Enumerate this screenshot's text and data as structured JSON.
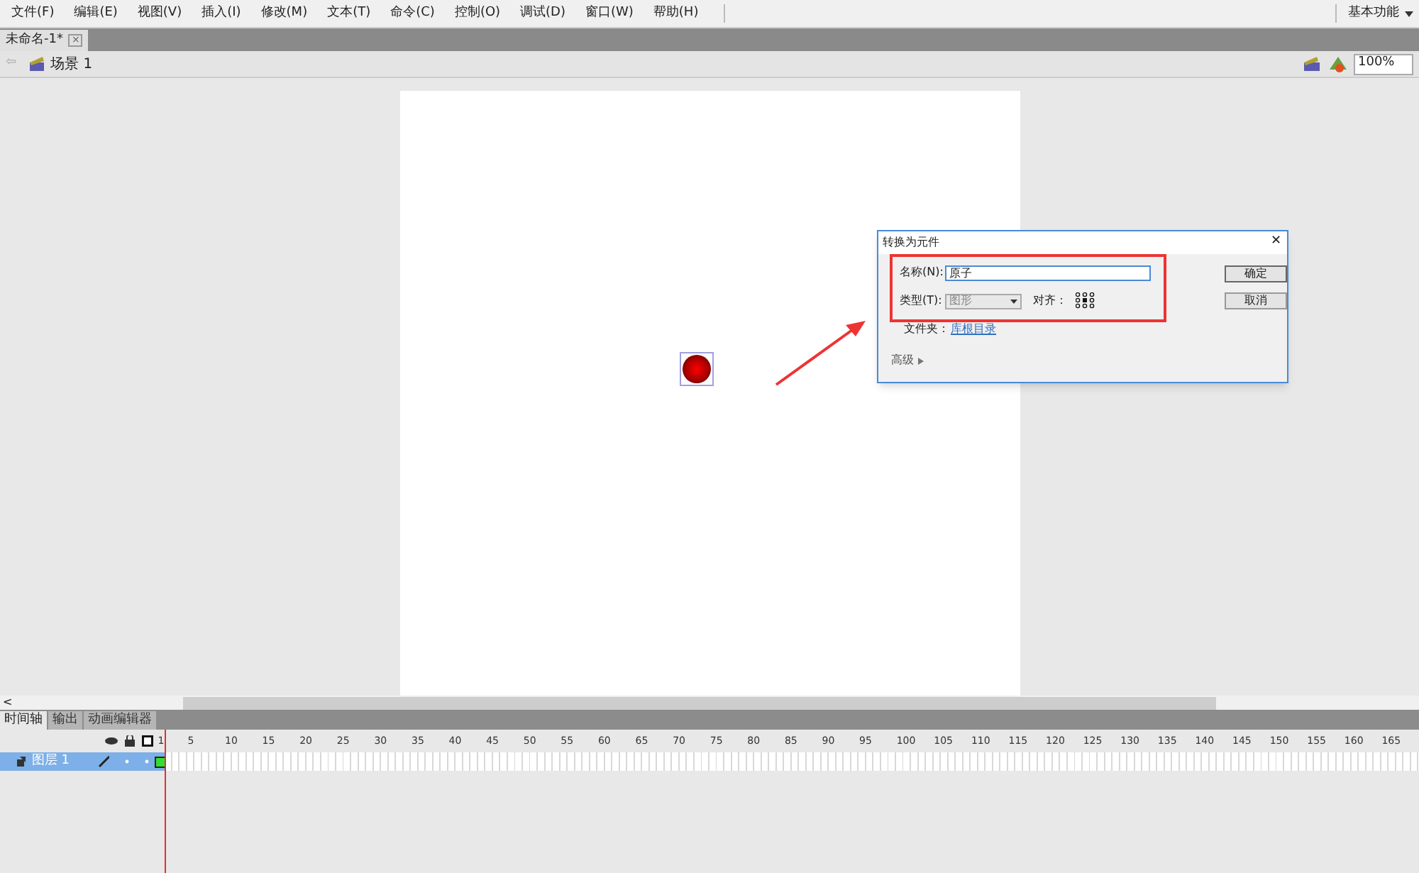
{
  "menu": [
    "文件(F)",
    "编辑(E)",
    "视图(V)",
    "插入(I)",
    "修改(M)",
    "文本(T)",
    "命令(C)",
    "控制(O)",
    "调试(D)",
    "窗口(W)",
    "帮助(H)"
  ],
  "workspace": "基本功能",
  "document_tab": {
    "label": "未命名-1*",
    "close": "×"
  },
  "scene": {
    "back": "⇦",
    "label": "场景 1",
    "zoom": "100%"
  },
  "dialog": {
    "title": "转换为元件",
    "close": "✕",
    "name_label": "名称(N):",
    "name_value": "原子",
    "type_label": "类型(T):",
    "type_value": "图形",
    "align_label": "对齐：",
    "folder_label": "文件夹：",
    "folder_link": "库根目录",
    "advanced": "高级",
    "ok": "确定",
    "cancel": "取消"
  },
  "scroll": {
    "left": "<"
  },
  "timeline_tabs": [
    {
      "label": "时间轴",
      "selected": true
    },
    {
      "label": "输出",
      "selected": false
    },
    {
      "label": "动画编辑器",
      "selected": false
    }
  ],
  "frame_numbers": [
    "1",
    "5",
    "10",
    "15",
    "20",
    "25",
    "30",
    "35",
    "40",
    "45",
    "50",
    "55",
    "60",
    "65",
    "70",
    "75",
    "80",
    "85",
    "90",
    "95",
    "100",
    "105",
    "110",
    "115",
    "120",
    "125",
    "130",
    "135",
    "140",
    "145",
    "150",
    "155",
    "160",
    "165"
  ],
  "layers": [
    {
      "name": "图层 1",
      "selected": true
    }
  ]
}
